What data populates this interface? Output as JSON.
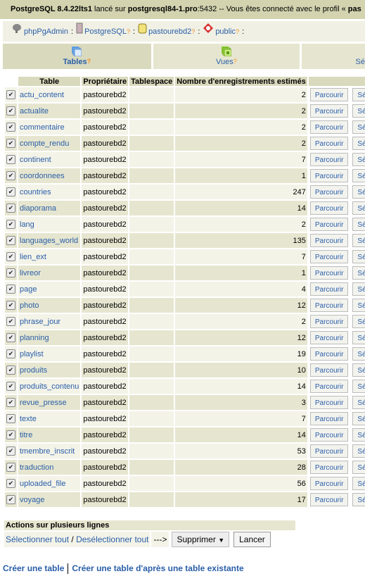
{
  "topbar": {
    "product": "PostgreSQL 8.4.22lts1",
    "launched": " lancé sur ",
    "host": "postgresql84-1.pro",
    "port_text": ":5432 -- Vous êtes connecté avec le profil « ",
    "user_partial": "pas"
  },
  "trail": [
    {
      "label": "phpPgAdmin",
      "icon": "elephant-icon",
      "help": ""
    },
    {
      "label": "PostgreSQL",
      "icon": "server-icon",
      "help": "?"
    },
    {
      "label": "pastourebd2",
      "icon": "database-icon",
      "help": "?"
    },
    {
      "label": "public",
      "icon": "schema-icon",
      "help": "?"
    }
  ],
  "trail_sep": ":",
  "tabs": [
    {
      "label": "Tables",
      "help": "?",
      "active": true
    },
    {
      "label": "Vues",
      "help": "?"
    },
    {
      "label": "Sé"
    }
  ],
  "columns": [
    "Table",
    "Propriétaire",
    "Tablespace",
    "Nombre d'enregistrements estimés",
    ""
  ],
  "rows": [
    [
      "actu_content",
      "pastourebd2",
      "",
      2
    ],
    [
      "actualite",
      "pastourebd2",
      "",
      2
    ],
    [
      "commentaire",
      "pastourebd2",
      "",
      2
    ],
    [
      "compte_rendu",
      "pastourebd2",
      "",
      2
    ],
    [
      "continent",
      "pastourebd2",
      "",
      7
    ],
    [
      "coordonnees",
      "pastourebd2",
      "",
      1
    ],
    [
      "countries",
      "pastourebd2",
      "",
      247
    ],
    [
      "diaporama",
      "pastourebd2",
      "",
      14
    ],
    [
      "lang",
      "pastourebd2",
      "",
      2
    ],
    [
      "languages_world",
      "pastourebd2",
      "",
      135
    ],
    [
      "lien_ext",
      "pastourebd2",
      "",
      7
    ],
    [
      "livreor",
      "pastourebd2",
      "",
      1
    ],
    [
      "page",
      "pastourebd2",
      "",
      4
    ],
    [
      "photo",
      "pastourebd2",
      "",
      12
    ],
    [
      "phrase_jour",
      "pastourebd2",
      "",
      2
    ],
    [
      "planning",
      "pastourebd2",
      "",
      12
    ],
    [
      "playlist",
      "pastourebd2",
      "",
      19
    ],
    [
      "produits",
      "pastourebd2",
      "",
      10
    ],
    [
      "produits_contenu",
      "pastourebd2",
      "",
      14
    ],
    [
      "revue_presse",
      "pastourebd2",
      "",
      3
    ],
    [
      "texte",
      "pastourebd2",
      "",
      7
    ],
    [
      "titre",
      "pastourebd2",
      "",
      14
    ],
    [
      "tmembre_inscrit",
      "pastourebd2",
      "",
      53
    ],
    [
      "traduction",
      "pastourebd2",
      "",
      28
    ],
    [
      "uploaded_file",
      "pastourebd2",
      "",
      56
    ],
    [
      "voyage",
      "pastourebd2",
      "",
      17
    ]
  ],
  "row_actions": {
    "browse": "Parcourir",
    "select": "Sél"
  },
  "actions": {
    "title": "Actions sur plusieurs lignes",
    "select_all": "Sélectionner tout",
    "slash": " / ",
    "deselect_all": "Desélectionner tout",
    "arrow": "--->",
    "dropdown": "Supprimer",
    "go": "Lancer"
  },
  "bottom": {
    "create": "Créer une table",
    "create_like": "Créer une table d'après une table existante"
  }
}
